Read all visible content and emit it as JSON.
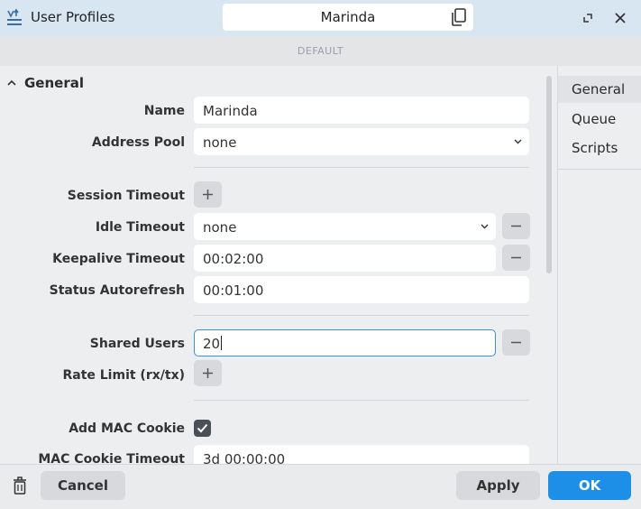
{
  "window": {
    "title": "User Profiles",
    "profile_name": "Marinda",
    "mode_label": "DEFAULT"
  },
  "section": {
    "title": "General"
  },
  "form": {
    "name": {
      "label": "Name",
      "value": "Marinda"
    },
    "address_pool": {
      "label": "Address Pool",
      "value": "none"
    },
    "session_timeout": {
      "label": "Session Timeout"
    },
    "idle_timeout": {
      "label": "Idle Timeout",
      "value": "none"
    },
    "keepalive_timeout": {
      "label": "Keepalive Timeout",
      "value": "00:02:00"
    },
    "status_autorefresh": {
      "label": "Status Autorefresh",
      "value": "00:01:00"
    },
    "shared_users": {
      "label": "Shared Users",
      "value": "20"
    },
    "rate_limit": {
      "label": "Rate Limit (rx/tx)"
    },
    "add_mac_cookie": {
      "label": "Add MAC Cookie",
      "checked": true
    },
    "mac_cookie_timeout": {
      "label": "MAC Cookie Timeout",
      "value": "3d 00:00:00"
    }
  },
  "sidebar": {
    "items": [
      {
        "label": "General",
        "active": true
      },
      {
        "label": "Queue",
        "active": false
      },
      {
        "label": "Scripts",
        "active": false
      }
    ]
  },
  "footer": {
    "cancel_label": "Cancel",
    "apply_label": "Apply",
    "ok_label": "OK"
  },
  "colors": {
    "accent": "#1e8fe6",
    "titlebar": "#d8e6f2",
    "focus_border": "#3d8fd6"
  },
  "icons": [
    "app-icon",
    "copy-icon",
    "restore-icon",
    "close-icon",
    "chevron-up-icon",
    "chevron-down-icon",
    "plus-icon",
    "minus-icon",
    "checkmark-icon",
    "trash-icon"
  ]
}
